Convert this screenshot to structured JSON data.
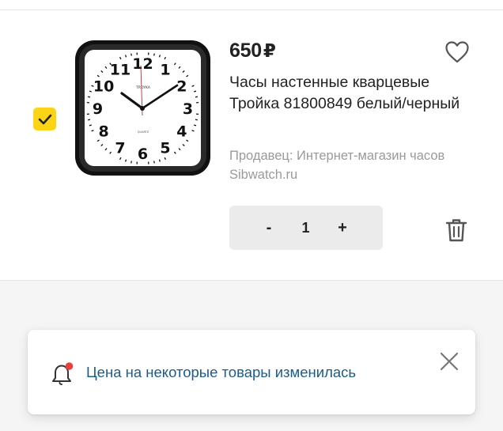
{
  "product": {
    "price": "650",
    "currency": "₽",
    "title": "Часы настенные кварцевые Тройка 81800849 белый/черный",
    "seller": "Продавец: Интернет-магазин часов Sibwatch.ru",
    "quantity": "1",
    "selected": true,
    "image_icon": "wall-clock-image",
    "clock_brand": "TROYKA",
    "clock_sub_label": "QUARTZ",
    "clock_numbers": [
      "12",
      "1",
      "2",
      "3",
      "4",
      "5",
      "6",
      "7",
      "8",
      "9",
      "10",
      "11"
    ]
  },
  "stepper": {
    "minus_label": "-",
    "plus_label": "+"
  },
  "notice": {
    "text": "Цена на некоторые товары изменилась"
  },
  "colors": {
    "checkbox": "#fcd416",
    "notice_text": "#1a5c8a",
    "notice_dot": "#e8413b"
  }
}
